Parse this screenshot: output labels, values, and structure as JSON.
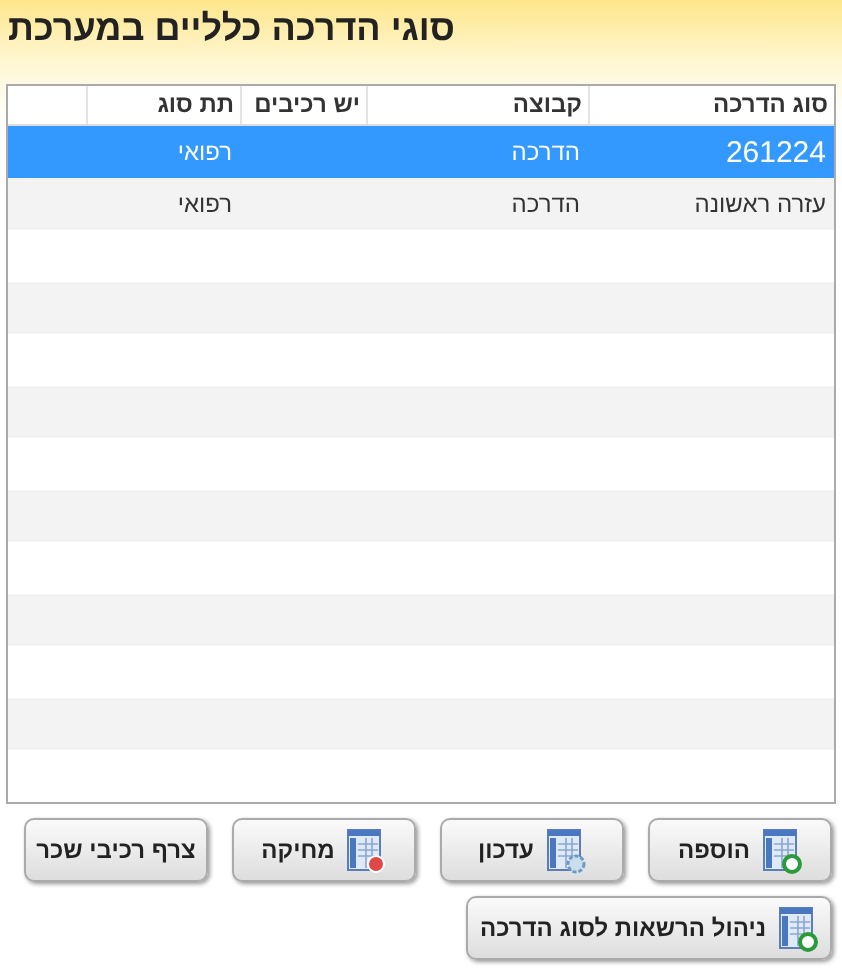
{
  "title": "סוגי הדרכה כלליים במערכת",
  "table": {
    "columns": [
      "סוג הדרכה",
      "קבוצה",
      "יש רכיבים",
      "תת סוג"
    ],
    "rows": [
      {
        "cells": [
          "261224",
          "הדרכה",
          "",
          "רפואי"
        ],
        "selected": true
      },
      {
        "cells": [
          "עזרה ראשונה",
          "הדרכה",
          "",
          "רפואי"
        ],
        "selected": false
      }
    ]
  },
  "buttons": [
    {
      "label": "הוספה",
      "kind": "add"
    },
    {
      "label": "עדכון",
      "kind": "edit"
    },
    {
      "label": "מחיקה",
      "kind": "delete"
    },
    {
      "label": "צרף רכיבי שכר",
      "kind": "plain"
    }
  ],
  "bottom_button": {
    "label": "ניהול הרשאות לסוג הדרכה",
    "kind": "add"
  }
}
